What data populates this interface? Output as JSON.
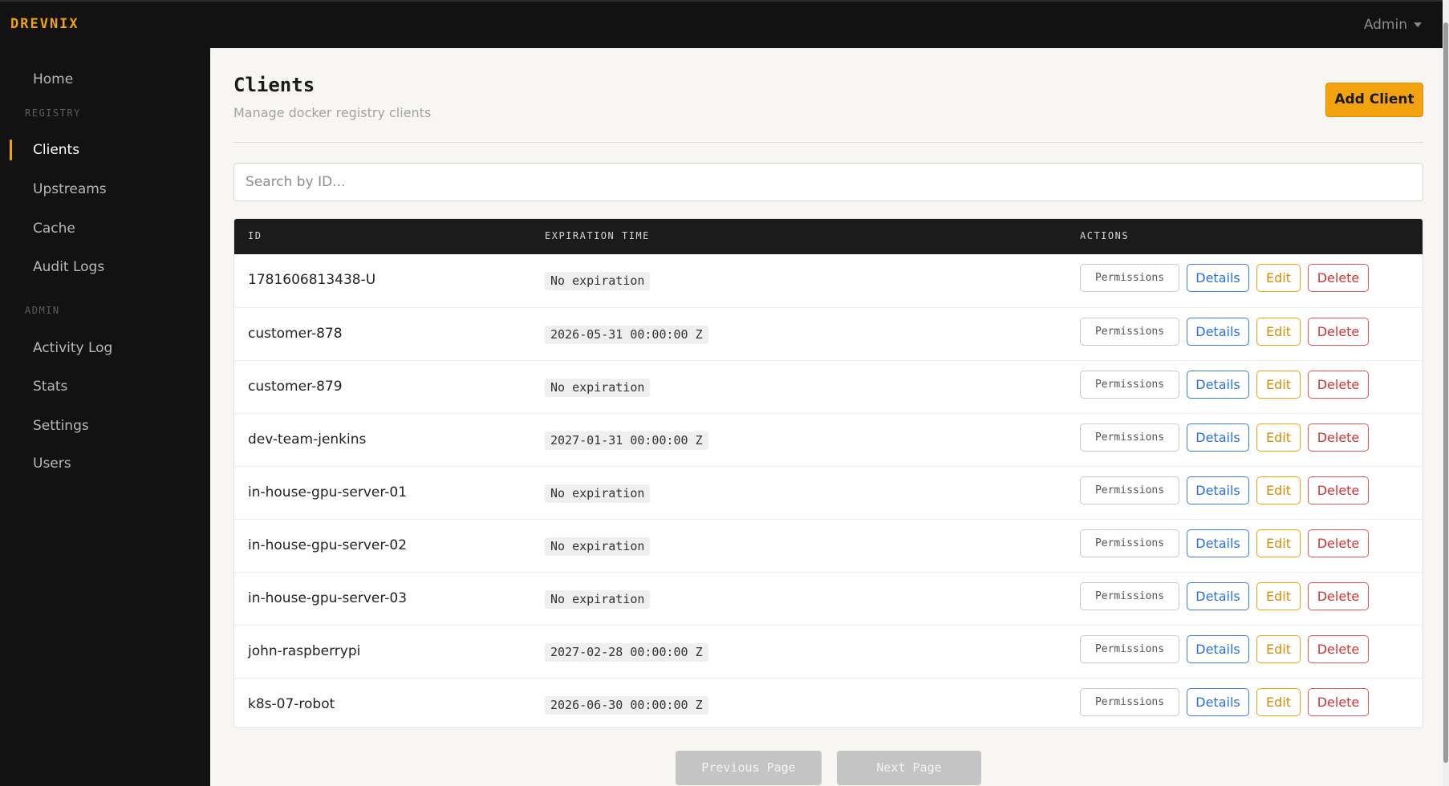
{
  "header": {
    "brand": "DREVNIX",
    "user": "Admin"
  },
  "sidebar": {
    "home": "Home",
    "registry_section": "REGISTRY",
    "registry_items": [
      "Clients",
      "Upstreams",
      "Cache",
      "Audit Logs"
    ],
    "admin_section": "ADMIN",
    "admin_items": [
      "Activity Log",
      "Stats",
      "Settings",
      "Users"
    ],
    "active": "Clients"
  },
  "main": {
    "title": "Clients",
    "subtitle": "Manage docker registry clients",
    "add_button": "Add Client",
    "search_placeholder": "Search by ID..."
  },
  "table": {
    "columns": [
      "ID",
      "EXPIRATION TIME",
      "ACTIONS"
    ],
    "rows": [
      {
        "id": "1781606813438-U",
        "expiration": "No expiration"
      },
      {
        "id": "customer-878",
        "expiration": "2026-05-31 00:00:00 Z"
      },
      {
        "id": "customer-879",
        "expiration": "No expiration"
      },
      {
        "id": "dev-team-jenkins",
        "expiration": "2027-01-31 00:00:00 Z"
      },
      {
        "id": "in-house-gpu-server-01",
        "expiration": "No expiration"
      },
      {
        "id": "in-house-gpu-server-02",
        "expiration": "No expiration"
      },
      {
        "id": "in-house-gpu-server-03",
        "expiration": "No expiration"
      },
      {
        "id": "john-raspberrypi",
        "expiration": "2027-02-28 00:00:00 Z"
      },
      {
        "id": "k8s-07-robot",
        "expiration": "2026-06-30 00:00:00 Z"
      }
    ],
    "actions": {
      "permissions": "Permissions",
      "details": "Details",
      "edit": "Edit",
      "delete": "Delete"
    }
  },
  "pagination": {
    "previous": "Previous Page",
    "next": "Next Page"
  },
  "colors": {
    "accent": "#f0a30a",
    "dark": "#121212",
    "details": "#2a6fdb",
    "delete": "#d63030"
  }
}
